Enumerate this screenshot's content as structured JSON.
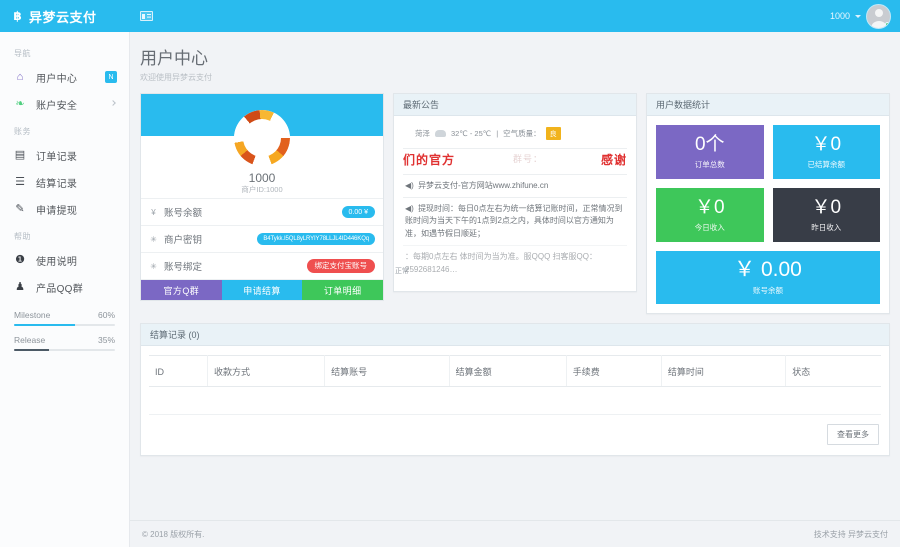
{
  "topbar": {
    "brand": "异梦云支付",
    "brand_logo_glyph": "฿",
    "toggle_name": "sidebar-toggle",
    "user_name": "1000"
  },
  "sidebar": {
    "groups": [
      {
        "title": "导航",
        "items": [
          {
            "label": "用户中心",
            "icon": "home-icon",
            "glyph": "⌂",
            "color": "#7b68c4",
            "badge": "N"
          },
          {
            "label": "账户安全",
            "icon": "leaf-icon",
            "glyph": "❧",
            "color": "#4fcf7f",
            "chevron": true
          }
        ]
      },
      {
        "title": "账务",
        "items": [
          {
            "label": "订单记录",
            "icon": "book-icon",
            "glyph": "▤",
            "color": "#4a4f56"
          },
          {
            "label": "结算记录",
            "icon": "list-icon",
            "glyph": "☰",
            "color": "#4a4f56"
          },
          {
            "label": "申请提现",
            "icon": "edit-icon",
            "glyph": "✎",
            "color": "#4a4f56"
          }
        ]
      },
      {
        "title": "帮助",
        "items": [
          {
            "label": "使用说明",
            "icon": "info-icon",
            "glyph": "❶",
            "color": "#3a3f46"
          },
          {
            "label": "产品QQ群",
            "icon": "bell-icon",
            "glyph": "♟",
            "color": "#3a3f46"
          }
        ]
      }
    ],
    "progress": [
      {
        "label": "Milestone",
        "percent": "60%",
        "value": 60,
        "style": "blue"
      },
      {
        "label": "Release",
        "percent": "35%",
        "value": 35,
        "style": "dark"
      }
    ]
  },
  "page": {
    "title": "用户中心",
    "subtitle": "欢迎使用异梦云支付"
  },
  "profile": {
    "name": "1000",
    "meta": "商户ID:1000",
    "avatar_name": "user-ball-avatar",
    "rows": [
      {
        "icon_glyph": "¥",
        "icon_name": "yen-icon",
        "label": "账号余额",
        "value": "0.00 ¥",
        "pill": "blue"
      },
      {
        "icon_glyph": "✳",
        "icon_name": "key-icon",
        "label": "商户密钥",
        "value": "B4Tykk.I5QL8yLRYIY78LLJL4ID446KQq",
        "pill": "key"
      },
      {
        "icon_glyph": "✳",
        "icon_name": "link-icon",
        "label": "账号绑定",
        "value": "绑定支付宝账号",
        "pill": "red",
        "aside": "正常"
      }
    ],
    "buttons": [
      {
        "label": "官方Q群",
        "style": "pb-purple",
        "name": "official-qq-group-button"
      },
      {
        "label": "申请结算",
        "style": "pb-blue",
        "name": "apply-settlement-button"
      },
      {
        "label": "订单明细",
        "style": "pb-green",
        "name": "order-detail-button"
      }
    ]
  },
  "notice": {
    "title": "最新公告",
    "weather": {
      "city": "菏泽",
      "icon_name": "cloud-icon",
      "temp": "32℃ - 25℃",
      "divider": "|",
      "aqi_label": "空气质量：",
      "aqi_value": "良"
    },
    "headline": "们的官方",
    "headline_faded": "群号：",
    "headline_right": "感谢",
    "items": [
      "异梦云支付-官方网站www.zhifune.cn",
      "提现时间：每日0点左右为统一结算记账时间，正常情况到账时间为当天下午的1点到2点之内，具体时间以官方通知为准，如遇节假日顺延；",
      "：每期0点左右 体时间为当为准。服QQQ 扫客服QQ：2592681246…"
    ]
  },
  "stats": {
    "title": "用户数据统计",
    "tiles": [
      {
        "value": "0个",
        "label": "订单总数",
        "style": "t-purple",
        "name": "stat-total-orders"
      },
      {
        "value": "￥0",
        "label": "已结算余额",
        "style": "t-cyan",
        "name": "stat-settled-balance"
      },
      {
        "value": "￥0",
        "label": "今日收入",
        "style": "t-green",
        "name": "stat-today-income"
      },
      {
        "value": "￥0",
        "label": "昨日收入",
        "style": "t-dark",
        "name": "stat-yesterday-income"
      },
      {
        "value": "￥ 0.00",
        "label": "账号余额",
        "style": "t-cyan",
        "wide": true,
        "name": "stat-account-balance"
      }
    ]
  },
  "settlement_table": {
    "title": "结算记录 (0)",
    "columns": [
      "ID",
      "收款方式",
      "结算账号",
      "结算金额",
      "手续费",
      "结算时间",
      "状态"
    ],
    "rows": [],
    "more_button": "查看更多"
  },
  "footer": {
    "left": "© 2018 版权所有.",
    "right": "技术支持 异梦云支付"
  },
  "colors": {
    "brand": "#29bbee",
    "purple": "#7b68c4",
    "green": "#3ec75a",
    "dark": "#383d47",
    "red": "#ef4f4f"
  }
}
